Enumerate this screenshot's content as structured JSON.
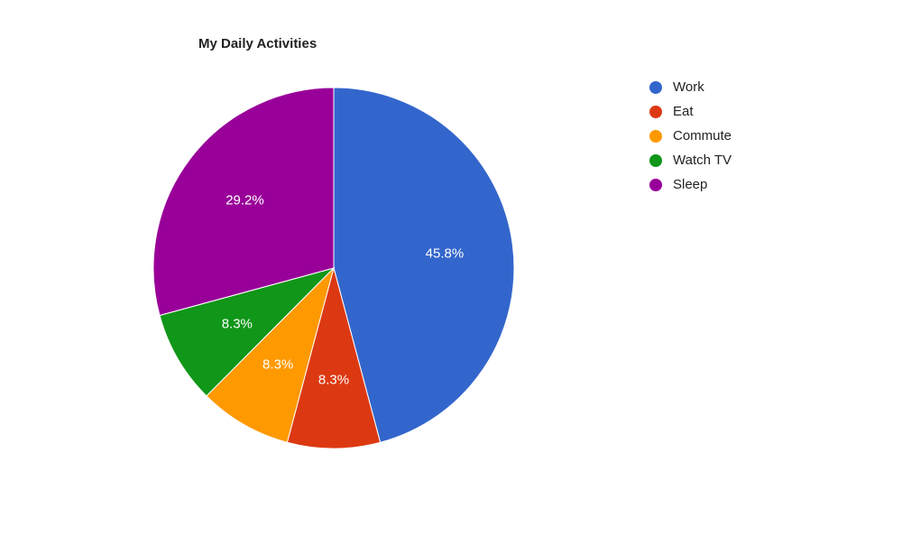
{
  "chart_data": {
    "type": "pie",
    "title": "My Daily Activities",
    "series": [
      {
        "name": "Work",
        "value": 45.8,
        "label": "45.8%",
        "color": "#3366cc"
      },
      {
        "name": "Eat",
        "value": 8.3,
        "label": "8.3%",
        "color": "#dc3912"
      },
      {
        "name": "Commute",
        "value": 8.3,
        "label": "8.3%",
        "color": "#ff9900"
      },
      {
        "name": "Watch TV",
        "value": 8.3,
        "label": "8.3%",
        "color": "#109618"
      },
      {
        "name": "Sleep",
        "value": 29.2,
        "label": "29.2%",
        "color": "#990099"
      }
    ],
    "legend_position": "right"
  }
}
